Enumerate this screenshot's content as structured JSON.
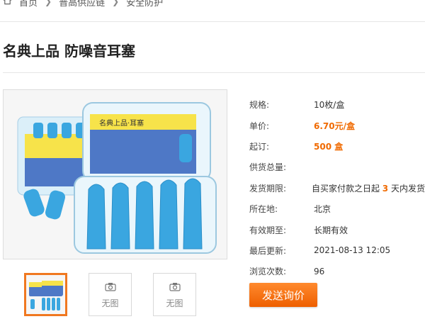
{
  "breadcrumb": {
    "home": "首页",
    "level2": "普高供应链",
    "level3": "安全防护"
  },
  "product": {
    "title": "名典上品 防噪音耳塞",
    "image_box_text": "名典上品·耳塞",
    "image_box_count": "5对"
  },
  "details": [
    {
      "label": "规格:",
      "value": "10枚/盒"
    },
    {
      "label": "单价:",
      "value": "6.70元/盒"
    },
    {
      "label": "起订:",
      "value": "500 盒"
    },
    {
      "label": "供货总量:",
      "value": ""
    },
    {
      "label": "发货期限:",
      "value_prefix": "自买家付款之日起",
      "value_highlight": "3",
      "value_suffix": "天内发货"
    },
    {
      "label": "所在地:",
      "value": "北京"
    },
    {
      "label": "有效期至:",
      "value": "长期有效"
    },
    {
      "label": "最后更新:",
      "value": "2021-08-13 12:05"
    },
    {
      "label": "浏览次数:",
      "value": "96"
    }
  ],
  "thumbnails": {
    "placeholder_text": "无图"
  },
  "actions": {
    "inquiry_label": "发送询价"
  },
  "colors": {
    "accent": "#f06a00",
    "button": "#f07820",
    "earplug": "#3aa6e0"
  }
}
